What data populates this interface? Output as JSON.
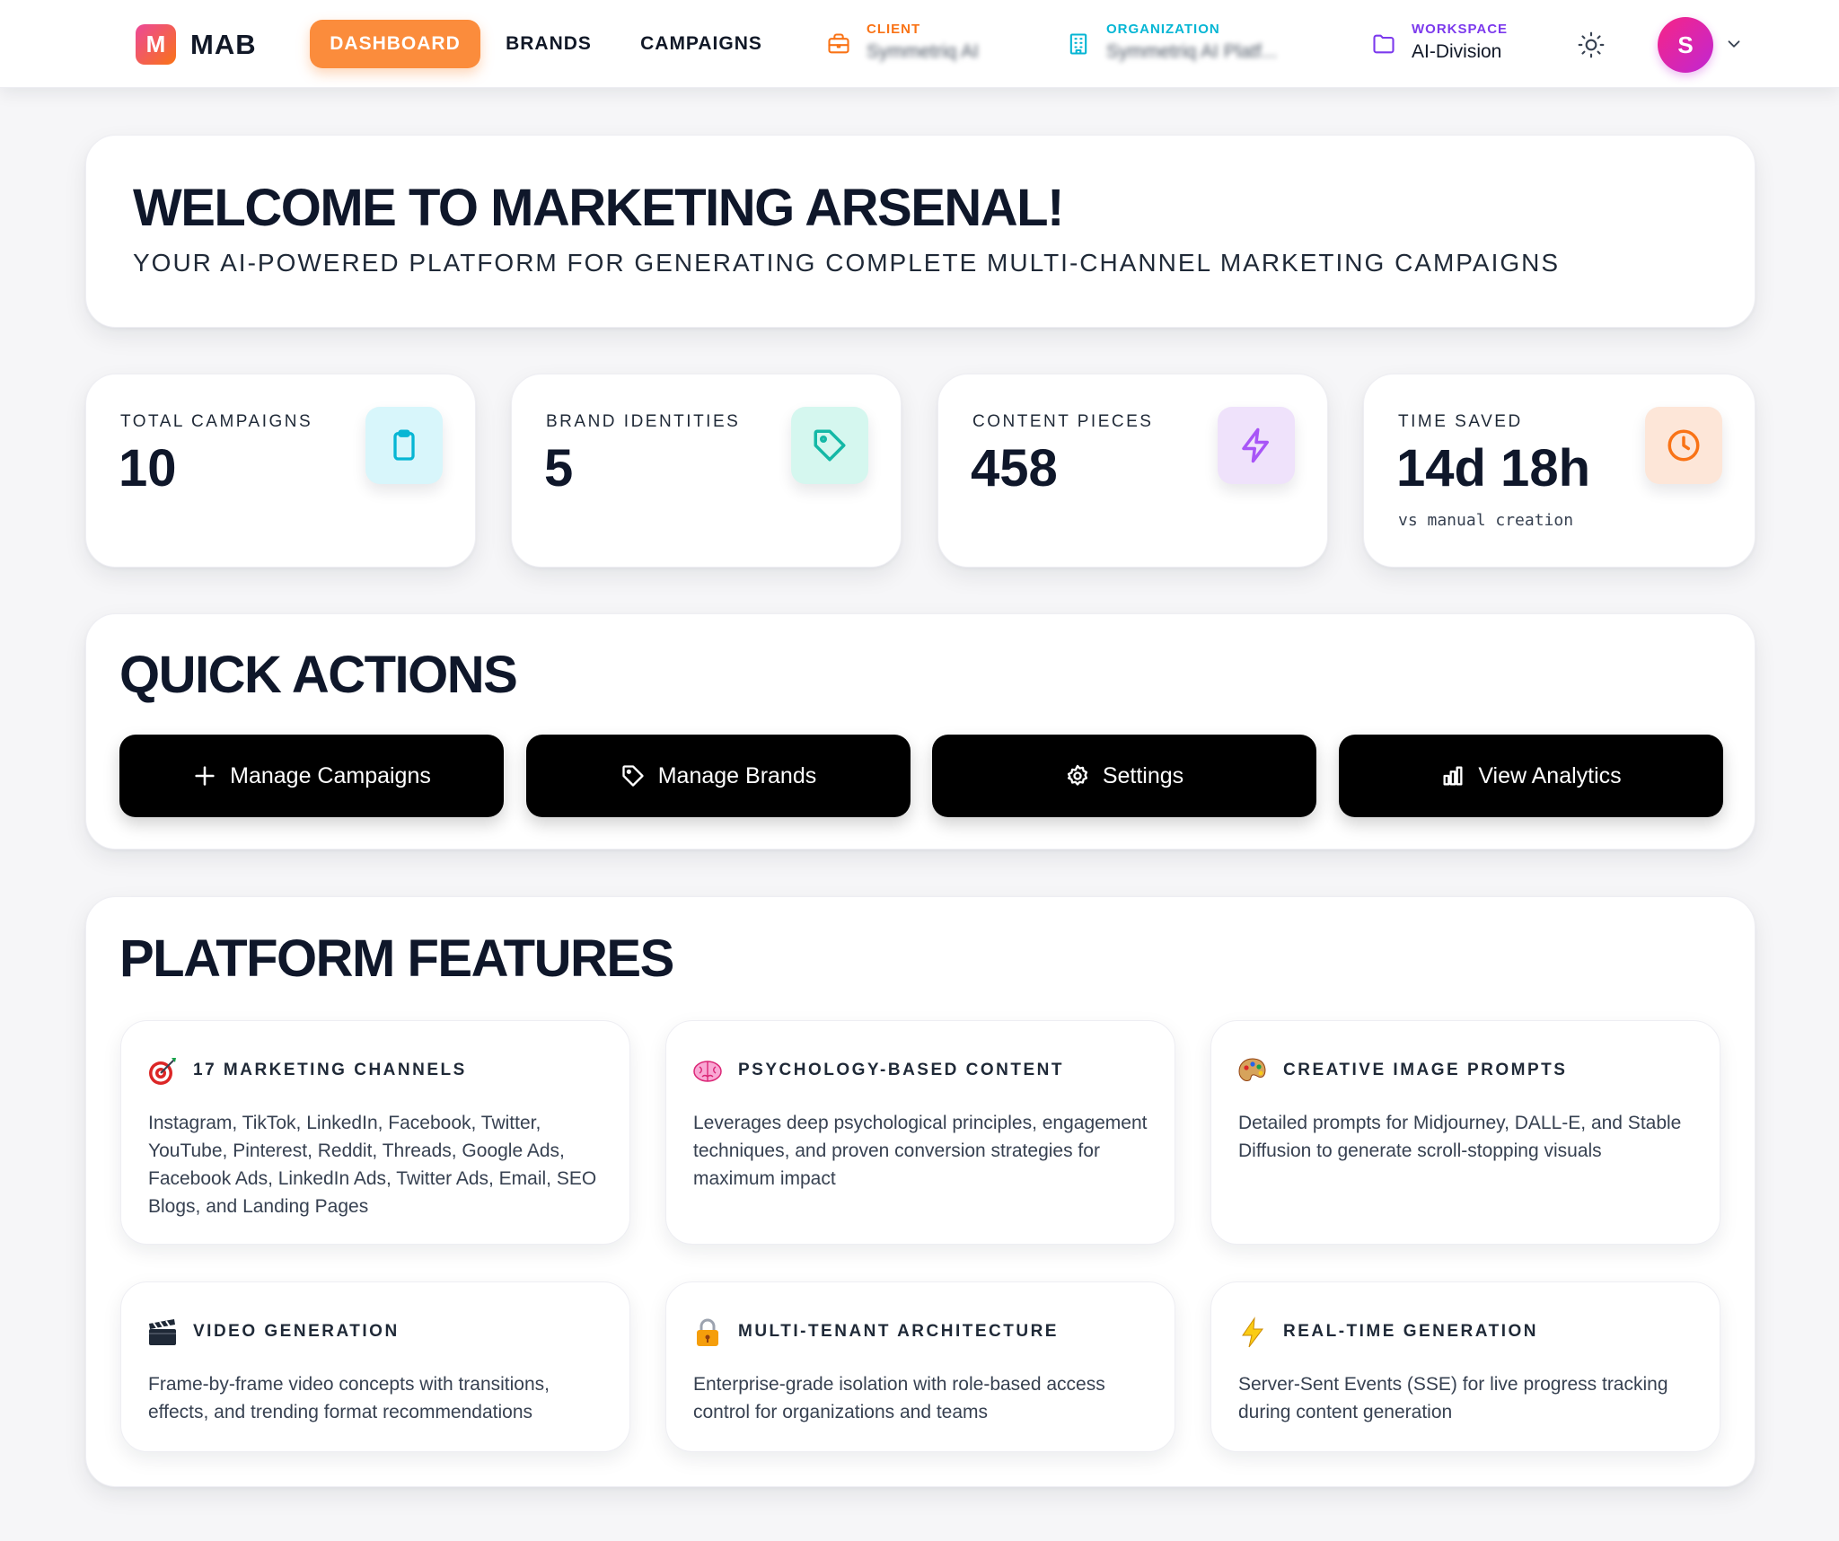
{
  "header": {
    "logo_letter": "M",
    "logo_text": "MAB",
    "nav": [
      {
        "label": "DASHBOARD",
        "active": true
      },
      {
        "label": "BRANDS",
        "active": false
      },
      {
        "label": "CAMPAIGNS",
        "active": false
      }
    ],
    "client": {
      "label": "CLIENT",
      "value": "Symmetriq AI",
      "color": "#f97316",
      "icon": "briefcase-icon"
    },
    "organization": {
      "label": "ORGANIZATION",
      "value": "Symmetriq AI Platf...",
      "color": "#06b6d4",
      "icon": "building-icon"
    },
    "workspace": {
      "label": "WORKSPACE",
      "value": "AI-Division",
      "color": "#7c3aed",
      "icon": "folder-icon"
    },
    "avatar_initial": "S"
  },
  "welcome": {
    "title": "WELCOME TO MARKETING ARSENAL!",
    "subtitle": "YOUR AI-POWERED PLATFORM FOR GENERATING COMPLETE MULTI-CHANNEL MARKETING CAMPAIGNS"
  },
  "stats": [
    {
      "label": "TOTAL CAMPAIGNS",
      "value": "10",
      "note": "",
      "icon": "clipboard-icon",
      "color": "#06b6d4",
      "bg": "#d8f6fb"
    },
    {
      "label": "BRAND IDENTITIES",
      "value": "5",
      "note": "",
      "icon": "tag-icon",
      "color": "#14b8a6",
      "bg": "#d5f7ef"
    },
    {
      "label": "CONTENT PIECES",
      "value": "458",
      "note": "",
      "icon": "lightning-icon",
      "color": "#a855f7",
      "bg": "#efe2fb"
    },
    {
      "label": "TIME SAVED",
      "value": "14d 18h",
      "note": "vs manual creation",
      "icon": "clock-icon",
      "color": "#f97316",
      "bg": "#fde6d8"
    }
  ],
  "quick_actions": {
    "title": "QUICK ACTIONS",
    "buttons": [
      {
        "label": "Manage Campaigns",
        "icon": "plus-icon"
      },
      {
        "label": "Manage Brands",
        "icon": "tag-icon"
      },
      {
        "label": "Settings",
        "icon": "gear-icon"
      },
      {
        "label": "View Analytics",
        "icon": "bar-chart-icon"
      }
    ]
  },
  "features": {
    "title": "PLATFORM FEATURES",
    "items": [
      {
        "title": "17 MARKETING CHANNELS",
        "icon": "target-icon",
        "desc": "Instagram, TikTok, LinkedIn, Facebook, Twitter, YouTube, Pinterest, Reddit, Threads, Google Ads, Facebook Ads, LinkedIn Ads, Twitter Ads, Email, SEO Blogs, and Landing Pages"
      },
      {
        "title": "PSYCHOLOGY-BASED CONTENT",
        "icon": "brain-icon",
        "desc": "Leverages deep psychological principles, engagement techniques, and proven conversion strategies for maximum impact"
      },
      {
        "title": "CREATIVE IMAGE PROMPTS",
        "icon": "palette-icon",
        "desc": "Detailed prompts for Midjourney, DALL-E, and Stable Diffusion to generate scroll-stopping visuals"
      },
      {
        "title": "VIDEO GENERATION",
        "icon": "clapperboard-icon",
        "desc": "Frame-by-frame video concepts with transitions, effects, and trending format recommendations"
      },
      {
        "title": "MULTI-TENANT ARCHITECTURE",
        "icon": "lock-icon",
        "desc": "Enterprise-grade isolation with role-based access control for organizations and teams"
      },
      {
        "title": "REAL-TIME GENERATION",
        "icon": "lightning-icon",
        "desc": "Server-Sent Events (SSE) for live progress tracking during content generation"
      }
    ]
  }
}
